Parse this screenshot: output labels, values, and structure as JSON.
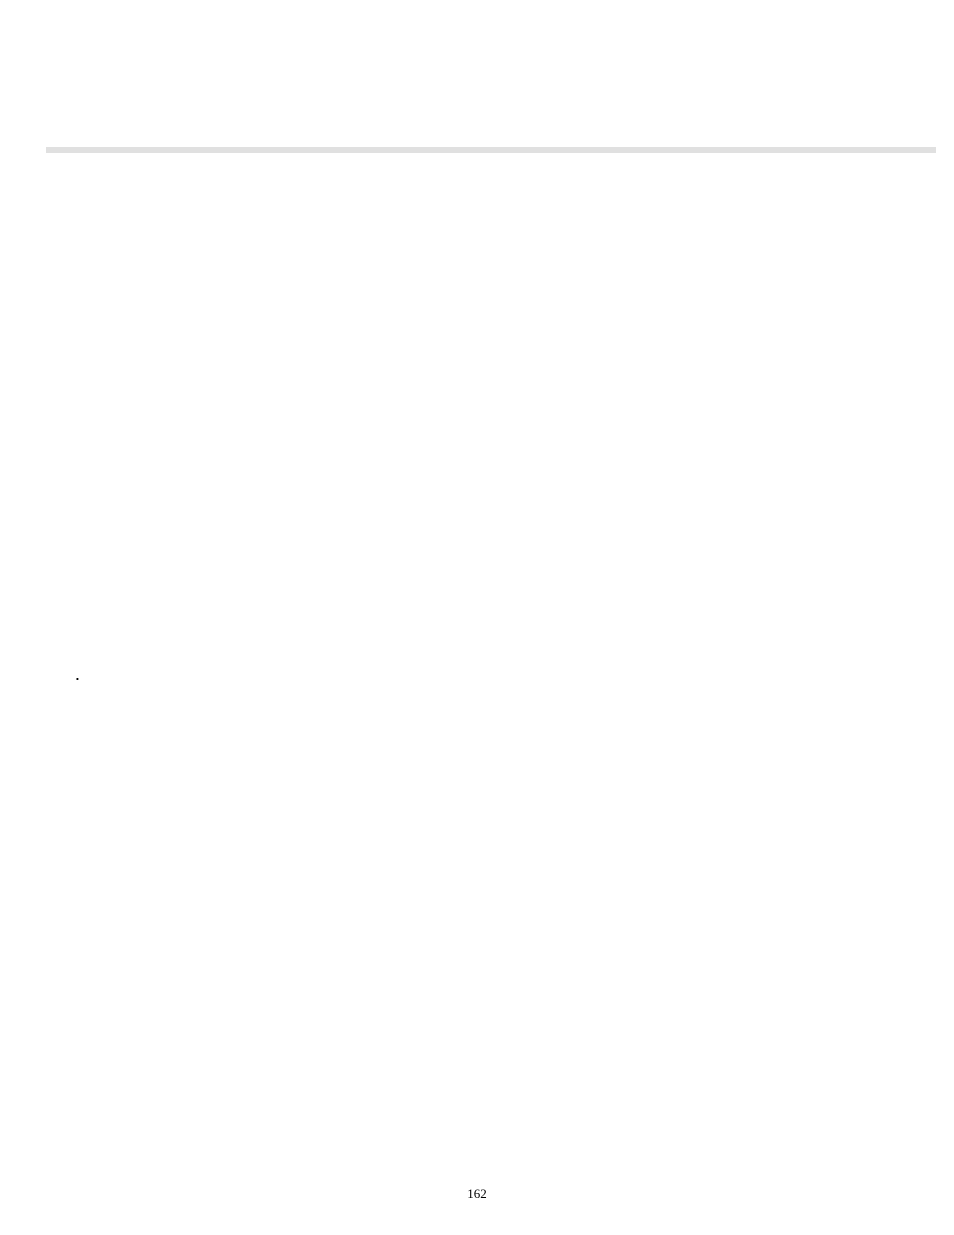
{
  "bullets": [
    {
      "text": ""
    },
    {
      "text": ""
    },
    {
      "text": ""
    },
    {
      "text": ""
    }
  ],
  "page_number": "162"
}
